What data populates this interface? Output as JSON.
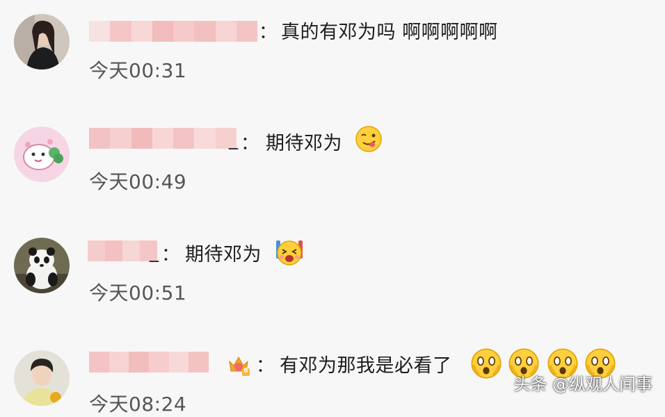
{
  "comments": [
    {
      "name_suffix": "",
      "separator": "：",
      "text": "真的有邓为吗 啊啊啊啊啊",
      "time": "今天00:31",
      "avatar": "woman-portrait"
    },
    {
      "name_suffix": "_",
      "separator": "：",
      "text": "期待邓为",
      "time": "今天00:49",
      "avatar": "pink-cartoon",
      "emoji": "yum-emoji"
    },
    {
      "name_suffix": "_",
      "separator": "：",
      "text": "期待邓为",
      "time": "今天00:51",
      "avatar": "panda",
      "emoji": "excited-emoji"
    },
    {
      "name_suffix": "",
      "separator": "：",
      "text": "有邓为那我是必看了",
      "time": "今天08:24",
      "avatar": "man-portrait",
      "badge": "6",
      "emoji": "shocked-emoji"
    }
  ],
  "watermark": "头条 @纵观人间事",
  "colors": {
    "background": "#f7f7f7",
    "text": "#1c1c1c",
    "time": "#555555",
    "name_blur": "#f4b9b9"
  }
}
